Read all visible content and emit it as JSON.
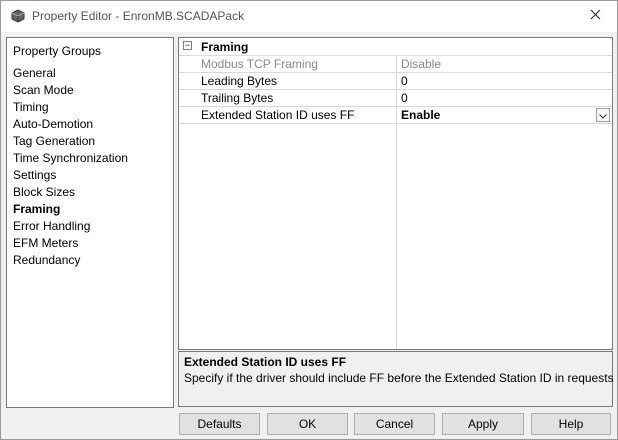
{
  "window": {
    "title": "Property Editor - EnronMB.SCADAPack"
  },
  "groups": {
    "header": "Property Groups",
    "items": [
      "General",
      "Scan Mode",
      "Timing",
      "Auto-Demotion",
      "Tag Generation",
      "Time Synchronization",
      "Settings",
      "Block Sizes",
      "Framing",
      "Error Handling",
      "EFM Meters",
      "Redundancy"
    ],
    "active": "Framing"
  },
  "grid": {
    "category": {
      "toggle": "−",
      "label": "Framing"
    },
    "rows": [
      {
        "name": "Modbus TCP Framing",
        "value": "Disable",
        "state": "disabled"
      },
      {
        "name": "Leading Bytes",
        "value": "0",
        "state": "normal"
      },
      {
        "name": "Trailing Bytes",
        "value": "0",
        "state": "normal"
      },
      {
        "name": "Extended Station ID uses FF",
        "value": "Enable",
        "state": "selected"
      }
    ]
  },
  "description": {
    "title": "Extended Station ID uses FF",
    "text": "Specify if the driver should include FF before the Extended Station ID in requests"
  },
  "buttons": {
    "defaults": "Defaults",
    "ok": "OK",
    "cancel": "Cancel",
    "apply": "Apply",
    "help": "Help"
  },
  "icons": {
    "app": "property-editor-icon",
    "close": "close-icon",
    "dropdown": "chevron-down-icon"
  }
}
